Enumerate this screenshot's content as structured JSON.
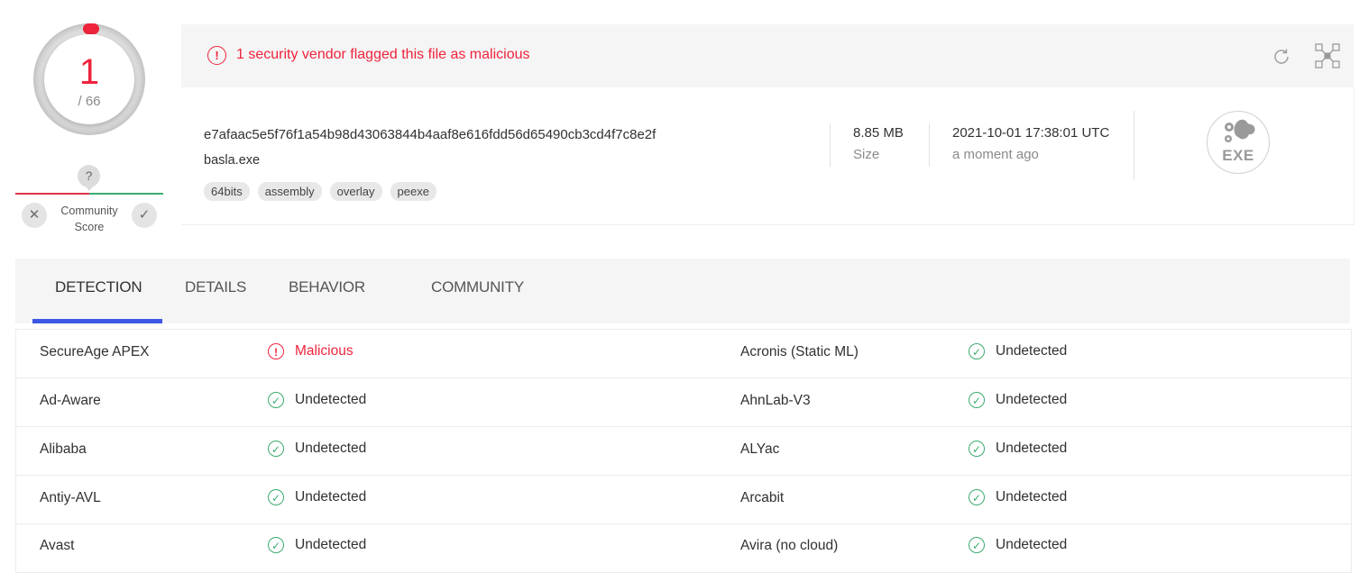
{
  "score": {
    "detections": "1",
    "total": "/ 66"
  },
  "community": {
    "question_mark": "?",
    "label_line1": "Community",
    "label_line2": "Score",
    "vote_malicious": "✕",
    "vote_harmless": "✓"
  },
  "alert": {
    "icon": "!",
    "text": "1 security vendor flagged this file as malicious"
  },
  "file": {
    "hash": "e7afaac5e5f76f1a54b98d43063844b4aaf8e616fdd56d65490cb3cd4f7c8e2f",
    "name": "basla.exe",
    "tags": [
      "64bits",
      "assembly",
      "overlay",
      "peexe"
    ],
    "size_value": "8.85 MB",
    "size_label": "Size",
    "date_value": "2021-10-01 17:38:01 UTC",
    "date_label": "a moment ago",
    "type_badge": "EXE"
  },
  "tabs": [
    {
      "label": "DETECTION",
      "active": true
    },
    {
      "label": "DETAILS",
      "active": false
    },
    {
      "label": "BEHAVIOR",
      "active": false
    },
    {
      "label": "COMMUNITY",
      "active": false
    }
  ],
  "detections": [
    {
      "left": {
        "vendor": "SecureAge APEX",
        "result": "Malicious",
        "status": "malicious"
      },
      "right": {
        "vendor": "Acronis (Static ML)",
        "result": "Undetected",
        "status": "undetected"
      }
    },
    {
      "left": {
        "vendor": "Ad-Aware",
        "result": "Undetected",
        "status": "undetected"
      },
      "right": {
        "vendor": "AhnLab-V3",
        "result": "Undetected",
        "status": "undetected"
      }
    },
    {
      "left": {
        "vendor": "Alibaba",
        "result": "Undetected",
        "status": "undetected"
      },
      "right": {
        "vendor": "ALYac",
        "result": "Undetected",
        "status": "undetected"
      }
    },
    {
      "left": {
        "vendor": "Antiy-AVL",
        "result": "Undetected",
        "status": "undetected"
      },
      "right": {
        "vendor": "Arcabit",
        "result": "Undetected",
        "status": "undetected"
      }
    },
    {
      "left": {
        "vendor": "Avast",
        "result": "Undetected",
        "status": "undetected"
      },
      "right": {
        "vendor": "Avira (no cloud)",
        "result": "Undetected",
        "status": "undetected"
      }
    }
  ],
  "icons": {
    "reload": "reload-icon",
    "graph": "graph-icon",
    "malicious": "alert-circle-icon",
    "undetected": "check-circle-icon"
  },
  "colors": {
    "malicious": "#ef233c",
    "undetected": "#3bab6e",
    "accent": "#3d57e5"
  }
}
